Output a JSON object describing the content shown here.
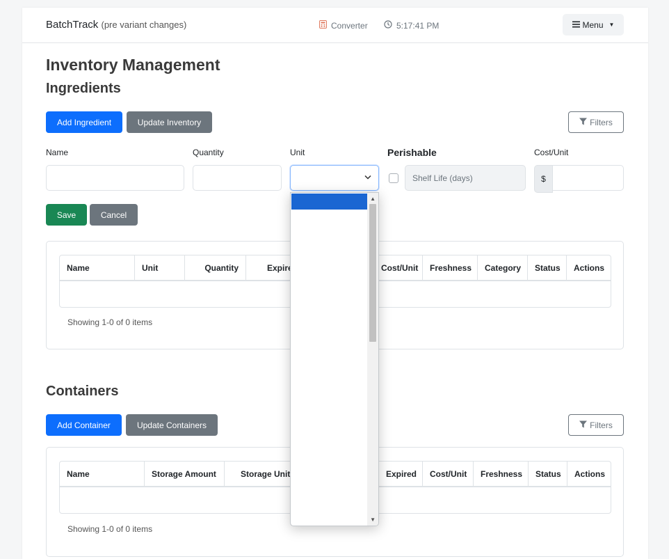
{
  "navbar": {
    "brand": "BatchTrack",
    "brand_sub": "(pre variant changes)",
    "converter": "Converter",
    "clock": "5:17:41 PM",
    "menu": "Menu"
  },
  "page_title": "Inventory Management",
  "ingredients": {
    "heading": "Ingredients",
    "add_button": "Add Ingredient",
    "update_button": "Update Inventory",
    "filters_button": "Filters",
    "form": {
      "name_label": "Name",
      "quantity_label": "Quantity",
      "unit_label": "Unit",
      "perishable_label": "Perishable",
      "shelf_life_placeholder": "Shelf Life (days)",
      "cost_label": "Cost/Unit",
      "currency_symbol": "$",
      "save_button": "Save",
      "cancel_button": "Cancel"
    },
    "table": {
      "columns": [
        "Name",
        "Unit",
        "Quantity",
        "Expired",
        "Cost/Unit",
        "Freshness",
        "Category",
        "Status",
        "Actions"
      ],
      "showing": "Showing 1-0 of 0 items"
    }
  },
  "containers": {
    "heading": "Containers",
    "add_button": "Add Container",
    "update_button": "Update Containers",
    "filters_button": "Filters",
    "table": {
      "columns": [
        "Name",
        "Storage Amount",
        "Storage Unit",
        "Expired",
        "Cost/Unit",
        "Freshness",
        "Status",
        "Actions"
      ],
      "showing": "Showing 1-0 of 0 items"
    }
  },
  "colors": {
    "primary": "#0d6efd",
    "secondary": "#6c757d",
    "success": "#198754"
  }
}
